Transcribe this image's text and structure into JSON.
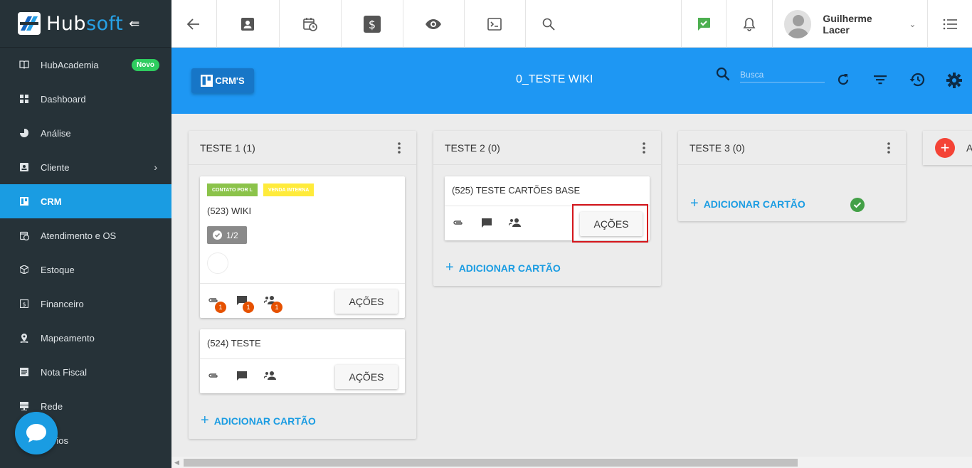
{
  "sidebar": {
    "logo": {
      "brand_primary": "Hub",
      "brand_secondary": "soft"
    },
    "items": [
      {
        "label": "HubAcademia",
        "icon": "book-icon",
        "badge": "Novo"
      },
      {
        "label": "Dashboard",
        "icon": "grid-icon"
      },
      {
        "label": "Análise",
        "icon": "pie-chart-icon"
      },
      {
        "label": "Cliente",
        "icon": "contact-card-icon"
      },
      {
        "label": "CRM",
        "icon": "board-icon"
      },
      {
        "label": "Atendimento e OS",
        "icon": "calendar-clock-icon"
      },
      {
        "label": "Estoque",
        "icon": "box-icon"
      },
      {
        "label": "Financeiro",
        "icon": "money-icon"
      },
      {
        "label": "Mapeamento",
        "icon": "map-pin-icon"
      },
      {
        "label": "Nota Fiscal",
        "icon": "document-icon"
      },
      {
        "label": "Rede",
        "icon": "server-icon"
      },
      {
        "label": "atórios",
        "icon": "report-icon"
      }
    ]
  },
  "topbar": {
    "user_name": "Guilherme Lacer"
  },
  "header": {
    "crm_button": "CRM'S",
    "board_title": "0_TESTE WIKI",
    "search_placeholder": "Busca"
  },
  "columns": [
    {
      "title": "TESTE 1 (1)",
      "add_label": "ADICIONAR CARTÃO",
      "cards": [
        {
          "tags": [
            "CONTATO POR L",
            "VENDA INTERNA"
          ],
          "title": "(523) WIKI",
          "checklist": "1/2",
          "counts": {
            "attachments": "1",
            "comments": "1",
            "members": "1"
          },
          "action": "AÇÕES"
        },
        {
          "title": "(524) TESTE",
          "action": "AÇÕES"
        }
      ]
    },
    {
      "title": "TESTE 2 (0)",
      "add_label": "ADICIONAR CARTÃO",
      "cards": [
        {
          "title": "(525) TESTE CARTÕES BASE",
          "action": "AÇÕES"
        }
      ]
    },
    {
      "title": "TESTE 3 (0)",
      "add_label": "ADICIONAR CARTÃO"
    },
    {
      "title": "A"
    }
  ],
  "colors": {
    "sidebar_bg": "#263238",
    "accent": "#1a9ce2",
    "header_blue": "#1e97f3",
    "tag_green": "#8bc34a",
    "tag_yellow": "#ffeb3b",
    "highlight": "#d4161c"
  }
}
